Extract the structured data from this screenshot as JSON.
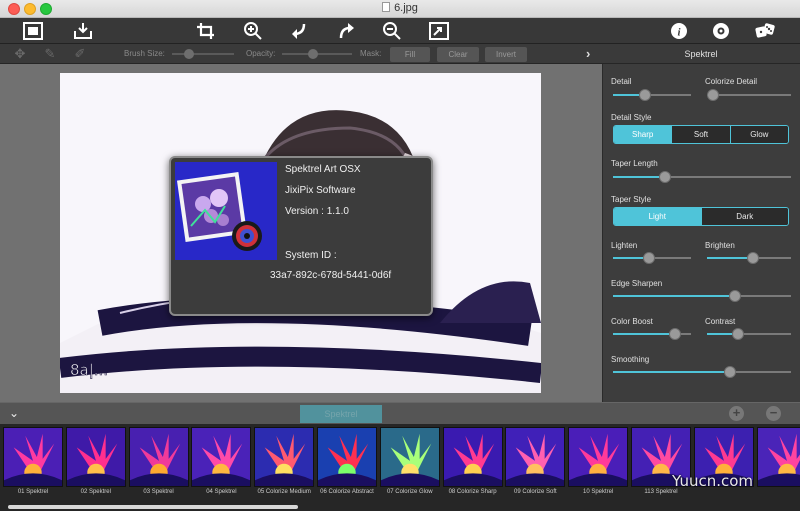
{
  "window": {
    "title": "6.jpg"
  },
  "toolbar": {
    "left_icons": [
      "image-frame-icon",
      "save-tray-icon"
    ],
    "center_icons": [
      "crop-icon",
      "zoom-in-icon",
      "undo-icon",
      "redo-icon",
      "zoom-out-icon",
      "fit-screen-icon"
    ],
    "right_icons": [
      "info-icon",
      "settings-icon",
      "randomize-dice-icon"
    ]
  },
  "subbar": {
    "brush_size_label": "Brush Size:",
    "opacity_label": "Opacity:",
    "mask_label": "Mask:",
    "fill_label": "Fill",
    "clear_label": "Clear",
    "invert_label": "Invert",
    "panel_toggle": "›"
  },
  "panel": {
    "title": "Spektrel",
    "detail": {
      "label": "Detail",
      "value": 0.4
    },
    "colorize_detail": {
      "label": "Colorize Detail",
      "value": 0.0
    },
    "detail_style": {
      "label": "Detail Style",
      "options": [
        "Sharp",
        "Soft",
        "Glow"
      ],
      "selected": "Sharp"
    },
    "taper_length": {
      "label": "Taper Length",
      "value": 0.28
    },
    "taper_style": {
      "label": "Taper Style",
      "options": [
        "Light",
        "Dark"
      ],
      "selected": "Light"
    },
    "lighten": {
      "label": "Lighten",
      "value": 0.45
    },
    "brighten": {
      "label": "Brighten",
      "value": 0.55
    },
    "edge_sharpen": {
      "label": "Edge Sharpen",
      "value": 0.7
    },
    "color_boost": {
      "label": "Color Boost",
      "value": 0.85
    },
    "contrast": {
      "label": "Contrast",
      "value": 0.35
    },
    "smoothing": {
      "label": "Smoothing",
      "value": 0.67
    }
  },
  "about": {
    "app_name": "Spektrel Art OSX",
    "company": "JixiPix Software",
    "version": "Version : 1.1.0",
    "system_id_label": "System ID :",
    "system_id": "33a7-892c-678d-5441-0d6f"
  },
  "photo_watermark": "8a|...",
  "bottombar": {
    "active_tab": "Spektrel",
    "collapse_icon": "chevron-down-icon",
    "add_icon": "plus-icon",
    "remove_icon": "minus-icon"
  },
  "presets": [
    {
      "label": "01 Spektrel"
    },
    {
      "label": "02 Spektrel"
    },
    {
      "label": "03 Spektrel"
    },
    {
      "label": "04 Spektrel"
    },
    {
      "label": "05 Colorize Medium"
    },
    {
      "label": "06 Colorize Abstract"
    },
    {
      "label": "07 Colorize Glow"
    },
    {
      "label": "08 Colorize Sharp"
    },
    {
      "label": "09 Colorize Soft"
    },
    {
      "label": "10 Spektrel"
    },
    {
      "label": "113 Spektrel"
    },
    {
      "label": ""
    },
    {
      "label": ""
    }
  ],
  "site_watermark": "Yuucn.com",
  "colors": {
    "accent": "#4fc4d9",
    "panel_bg": "#3d3d3d",
    "canvas_bg": "#717171"
  }
}
